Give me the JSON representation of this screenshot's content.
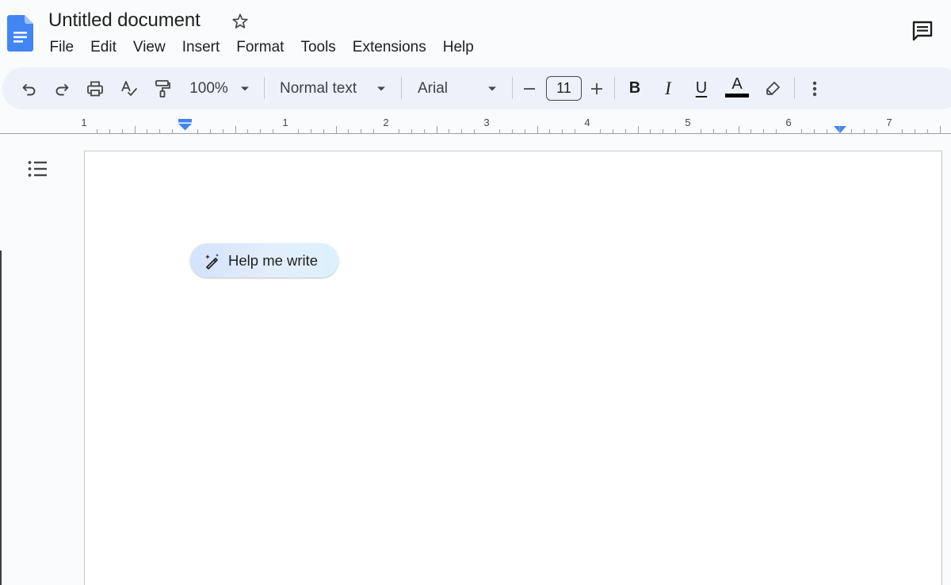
{
  "document": {
    "title": "Untitled document"
  },
  "menu": {
    "items": [
      "File",
      "Edit",
      "View",
      "Insert",
      "Format",
      "Tools",
      "Extensions",
      "Help"
    ]
  },
  "toolbar": {
    "zoom": "100%",
    "style": "Normal text",
    "font": "Arial",
    "font_size": "11",
    "bold_label": "B",
    "italic_label": "I",
    "underline_label": "U",
    "text_color_label": "A",
    "text_color": "#000000",
    "icons": [
      "undo-icon",
      "redo-icon",
      "print-icon",
      "spellcheck-icon",
      "paint-format-icon",
      "minus-icon",
      "plus-icon",
      "highlighter-icon",
      "more-vert-icon"
    ]
  },
  "ruler": {
    "labels": [
      "1",
      "1",
      "2",
      "3",
      "4",
      "5",
      "6",
      "7"
    ]
  },
  "page": {
    "help_me_write": "Help me write"
  },
  "colors": {
    "brand_blue": "#4285f4",
    "toolbar_bg": "#edf2fa",
    "page_bg": "#ffffff",
    "app_bg": "#f9fbfd"
  }
}
